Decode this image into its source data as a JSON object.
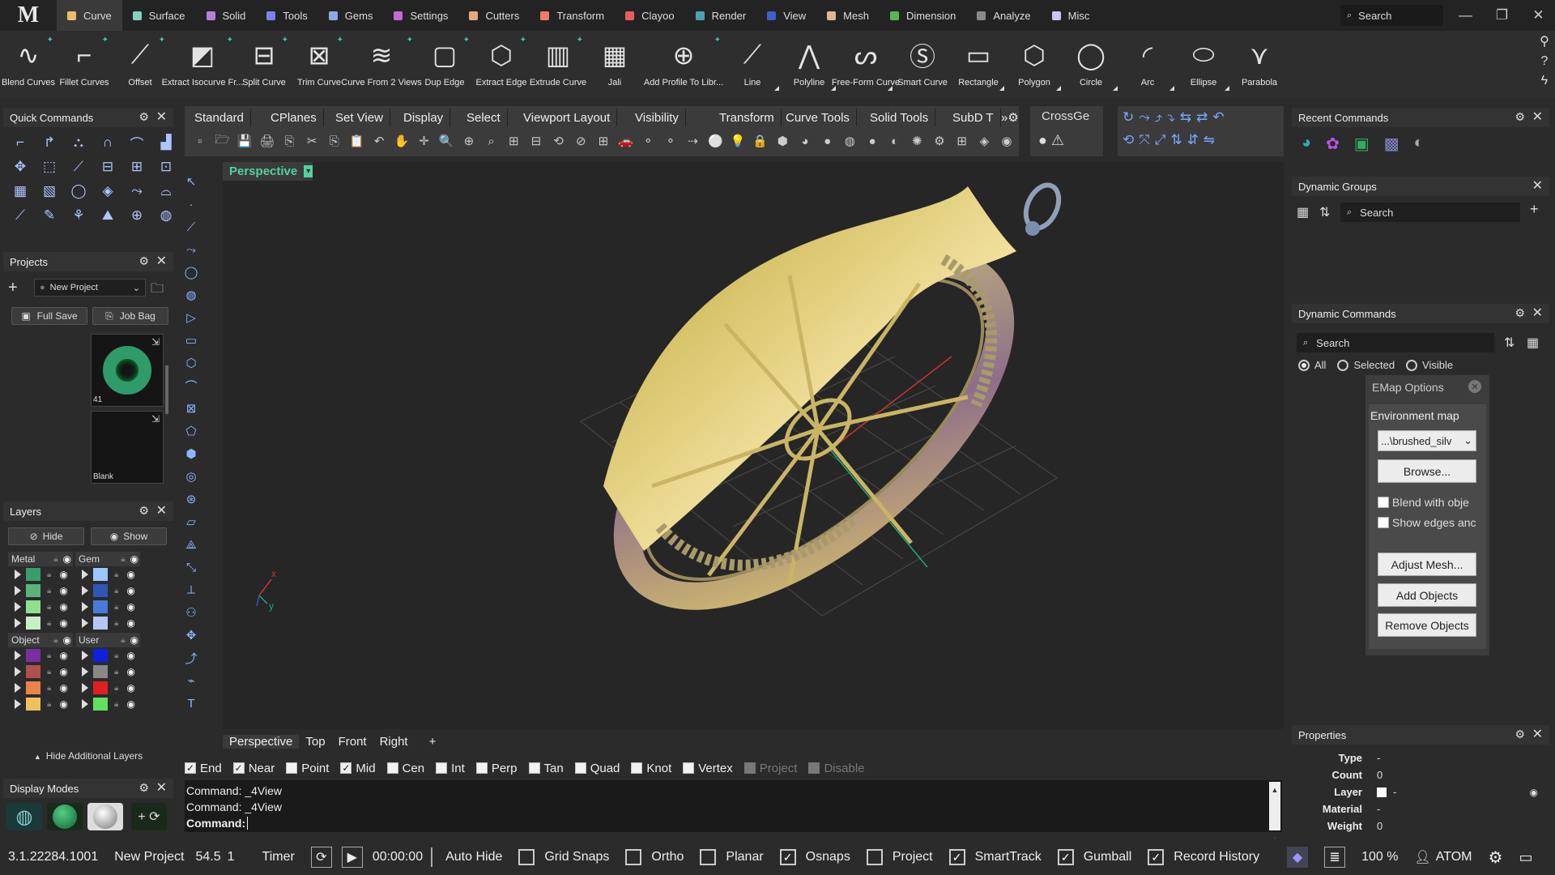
{
  "app": {
    "logo": "M"
  },
  "menu": {
    "tabs": [
      {
        "label": "Curve",
        "color": "#e8c16a",
        "active": true
      },
      {
        "label": "Surface",
        "color": "#7fd3c0"
      },
      {
        "label": "Solid",
        "color": "#b57fe0"
      },
      {
        "label": "Tools",
        "color": "#7f7ff0"
      },
      {
        "label": "Gems",
        "color": "#8fa7e8"
      },
      {
        "label": "Settings",
        "color": "#c46ad1"
      },
      {
        "label": "Cutters",
        "color": "#e8a87c"
      },
      {
        "label": "Transform",
        "color": "#f07a6b"
      },
      {
        "label": "Clayoo",
        "color": "#e85d5d"
      },
      {
        "label": "Render",
        "color": "#4aa3b0"
      },
      {
        "label": "View",
        "color": "#3d5fc9"
      },
      {
        "label": "Mesh",
        "color": "#d9b99b"
      },
      {
        "label": "Dimension",
        "color": "#57b757"
      },
      {
        "label": "Analyze",
        "color": "#8a8a8a"
      },
      {
        "label": "Misc",
        "color": "#c9c9f0"
      }
    ],
    "search_placeholder": "Search"
  },
  "ribbon": {
    "buttons": [
      {
        "label": "Blend Curves",
        "icon": "blend-icon",
        "glyph": "∿"
      },
      {
        "label": "Fillet Curves",
        "icon": "fillet-icon",
        "glyph": "⌐"
      },
      {
        "label": "Offset",
        "icon": "offset-icon",
        "glyph": "⟋"
      },
      {
        "label": "Extract Isocurve Fr...",
        "icon": "isocurve-icon",
        "glyph": "◩"
      },
      {
        "label": "Split Curve",
        "icon": "split-icon",
        "glyph": "⊟"
      },
      {
        "label": "Trim Curve",
        "icon": "trim-icon",
        "glyph": "⊠"
      },
      {
        "label": "Curve From 2 Views",
        "icon": "curve-2views-icon",
        "glyph": "≋"
      },
      {
        "label": "Dup Edge",
        "icon": "dup-edge-icon",
        "glyph": "▢"
      },
      {
        "label": "Extract Edge",
        "icon": "extract-edge-icon",
        "glyph": "⬡"
      },
      {
        "label": "Extrude Curve",
        "icon": "extrude-icon",
        "glyph": "▥"
      },
      {
        "label": "Jali",
        "icon": "jali-icon",
        "glyph": "▦"
      },
      {
        "label": "Add Profile To Libr...",
        "icon": "profile-icon",
        "glyph": "⊕"
      },
      {
        "label": "Line",
        "icon": "line-icon",
        "glyph": "⟋"
      },
      {
        "label": "Polyline",
        "icon": "polyline-icon",
        "glyph": "⋀"
      },
      {
        "label": "Free-Form Curve",
        "icon": "freeform-icon",
        "glyph": "ᔕ"
      },
      {
        "label": "Smart Curve",
        "icon": "smart-curve-icon",
        "glyph": "Ⓢ"
      },
      {
        "label": "Rectangle",
        "icon": "rectangle-icon",
        "glyph": "▭"
      },
      {
        "label": "Polygon",
        "icon": "polygon-icon",
        "glyph": "⬡"
      },
      {
        "label": "Circle",
        "icon": "circle-icon",
        "glyph": "◯"
      },
      {
        "label": "Arc",
        "icon": "arc-icon",
        "glyph": "◜"
      },
      {
        "label": "Ellipse",
        "icon": "ellipse-icon",
        "glyph": "⬭"
      },
      {
        "label": "Parabola",
        "icon": "parabola-icon",
        "glyph": "⋎"
      }
    ]
  },
  "quick_commands": {
    "title": "Quick Commands"
  },
  "projects": {
    "title": "Projects",
    "project_name": "New Project",
    "full_save": "Full Save",
    "job_bag": "Job Bag",
    "thumbs": [
      {
        "label": "41"
      },
      {
        "label": "Blank"
      }
    ]
  },
  "layers": {
    "title": "Layers",
    "hide": "Hide",
    "show": "Show",
    "groups": [
      {
        "name": "Metal",
        "colors": [
          "#3a9e6b",
          "#5bb37a",
          "#8ee08e",
          "#c5f0c5"
        ]
      },
      {
        "name": "Gem",
        "colors": [
          "#9cc7ff",
          "#2f56b8",
          "#4a7ad8",
          "#b5c8f5"
        ]
      },
      {
        "name": "Object",
        "colors": [
          "#7a2f9e",
          "#b05050",
          "#e8844a",
          "#f0c060"
        ]
      },
      {
        "name": "User",
        "colors": [
          "#1020e0",
          "#888888",
          "#e02020",
          "#60e060"
        ]
      }
    ],
    "hide_additional": "Hide Additional Layers"
  },
  "display_modes": {
    "title": "Display Modes"
  },
  "viewport": {
    "toolbar_tabs": [
      "Standard",
      "CPlanes",
      "Set View",
      "Display",
      "Select",
      "Viewport Layout",
      "Visibility",
      "Transform",
      "Curve Tools",
      "Solid Tools",
      "SubD T"
    ],
    "extra_tab": "CrossGe",
    "active_view": "Perspective",
    "view_tabs": [
      "Perspective",
      "Top",
      "Front",
      "Right"
    ],
    "add_tab": "+"
  },
  "osnaps": [
    {
      "label": "End",
      "checked": true
    },
    {
      "label": "Near",
      "checked": true
    },
    {
      "label": "Point",
      "checked": false
    },
    {
      "label": "Mid",
      "checked": true
    },
    {
      "label": "Cen",
      "checked": false
    },
    {
      "label": "Int",
      "checked": false
    },
    {
      "label": "Perp",
      "checked": false
    },
    {
      "label": "Tan",
      "checked": false
    },
    {
      "label": "Quad",
      "checked": false
    },
    {
      "label": "Knot",
      "checked": false
    },
    {
      "label": "Vertex",
      "checked": false
    },
    {
      "label": "Project",
      "checked": false,
      "disabled": true
    },
    {
      "label": "Disable",
      "checked": false,
      "disabled": true
    }
  ],
  "command": {
    "history": [
      "Command: _4View",
      "Command: _4View"
    ],
    "prompt": "Command:"
  },
  "status": {
    "version": "3.1.22284.1001",
    "project": "New Project",
    "value1": "54.5",
    "value2": "1",
    "timer": "Timer",
    "time": "00:00:00",
    "auto_hide": "Auto Hide",
    "toggles": [
      {
        "label": "Grid Snaps",
        "checked": false
      },
      {
        "label": "Ortho",
        "checked": false
      },
      {
        "label": "Planar",
        "checked": false
      },
      {
        "label": "Osnaps",
        "checked": true
      },
      {
        "label": "Project",
        "checked": false
      },
      {
        "label": "SmartTrack",
        "checked": true
      },
      {
        "label": "Gumball",
        "checked": true
      },
      {
        "label": "Record History",
        "checked": true
      }
    ],
    "zoom": "100 %",
    "user": "ATOM"
  },
  "recent": {
    "title": "Recent Commands"
  },
  "dyn_groups": {
    "title": "Dynamic Groups",
    "search": "Search"
  },
  "dyn_commands": {
    "title": "Dynamic Commands",
    "search": "Search",
    "radios": [
      {
        "label": "All",
        "on": true
      },
      {
        "label": "Selected",
        "on": false
      },
      {
        "label": "Visible",
        "on": false
      }
    ]
  },
  "emap": {
    "title": "EMap Options",
    "env_label": "Environment map",
    "env_value": "...\\brushed_silv",
    "browse": "Browse...",
    "blend": "Blend with obje",
    "show_edges": "Show edges anc",
    "adjust": "Adjust Mesh...",
    "add": "Add Objects",
    "remove": "Remove Objects"
  },
  "properties": {
    "title": "Properties",
    "rows": [
      {
        "k": "Type",
        "v": "-"
      },
      {
        "k": "Count",
        "v": "0"
      },
      {
        "k": "Layer",
        "v": "-"
      },
      {
        "k": "Material",
        "v": "-"
      },
      {
        "k": "Weight",
        "v": "0"
      }
    ]
  }
}
